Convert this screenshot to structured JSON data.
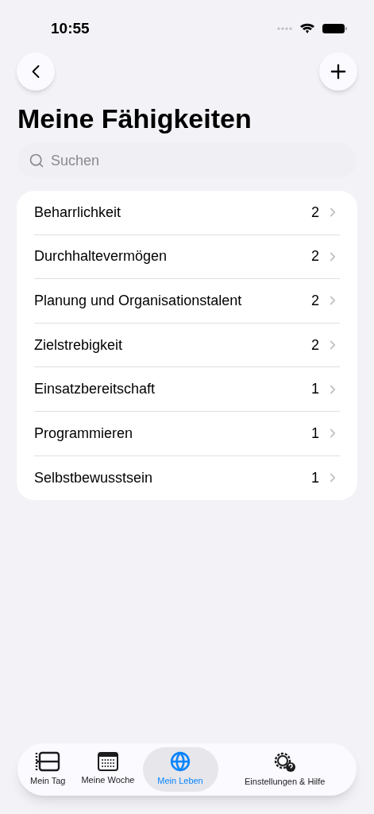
{
  "status_bar": {
    "time": "10:55"
  },
  "title": "Meine Fähigkeiten",
  "search": {
    "placeholder": "Suchen"
  },
  "skills": [
    {
      "name": "Beharrlichkeit",
      "count": "2"
    },
    {
      "name": "Durchhaltevermögen",
      "count": "2"
    },
    {
      "name": "Planung und Organisationstalent",
      "count": "2"
    },
    {
      "name": "Zielstrebigkeit",
      "count": "2"
    },
    {
      "name": "Einsatzbereitschaft",
      "count": "1"
    },
    {
      "name": "Programmieren",
      "count": "1"
    },
    {
      "name": "Selbstbewusstsein",
      "count": "1"
    }
  ],
  "tab_bar": [
    {
      "label": "Mein Tag",
      "kind": "day",
      "selected": false
    },
    {
      "label": "Meine Woche",
      "kind": "week",
      "selected": false
    },
    {
      "label": "Mein Leben",
      "kind": "life",
      "selected": true
    },
    {
      "label": "Einstellungen & Hilfe",
      "kind": "settings",
      "selected": false
    }
  ]
}
